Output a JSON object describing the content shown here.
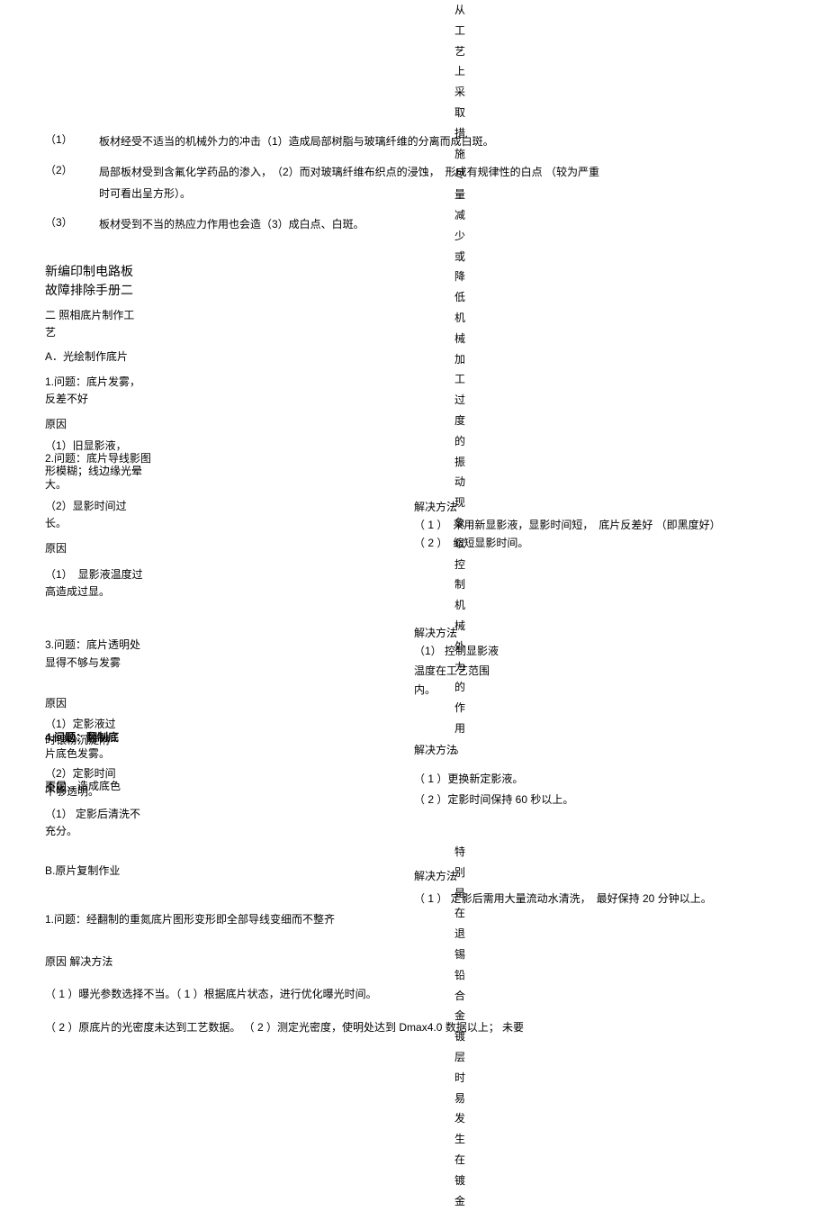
{
  "top_items": [
    {
      "num": "（1）",
      "content": "板材经受不适当的机械外力的冲击（1）造成局部树脂与玻璃纤维的分离而成白斑。",
      "right": "（1）"
    },
    {
      "num": "（2）",
      "content": "局部板材受到含氟化学药品的渗入，　（2）而对玻璃纤维布织点的浸蚀，　形成有规律性的白点 （较为严重时可看出呈方形）。",
      "right": "（2）"
    },
    {
      "num": "（3）",
      "content": "板材受到不当的热应力作用也会造（3）成白点、白斑。",
      "right": "（3）"
    }
  ],
  "title": "新编印制电路板故障排除手册二",
  "sec2": "二  照相底片制作工艺",
  "secA": "A．光绘制作底片",
  "q1": "1.问题：底片发雾，反差不好",
  "cause": "原因",
  "c1a": "（1）旧显影液，",
  "c1b": "2.问题：底片导线影图形模糊；线边缘光晕大。",
  "c1c": "（2）显影时间过长。",
  "c1d": "（1）　显影液温度过高造成过显。",
  "q3": "3.问题：底片透明处显得不够与发雾",
  "c3a": "（1）定影液过",
  "c3b": "4.问题：翻制底",
  "c3c": "时银粉沉淀附",
  "c3d": "片底色发雾。",
  "c3e": "（2）定影时间",
  "c3f": "不足，造成底色",
  "c3g": "原因",
  "c3h": "不够透明。",
  "c3i": "（1） 定影后清洗不充分。",
  "secB": "B.原片复制作业",
  "qB1": "1.问题：经翻制的重氮底片图形变形即全部导线变细而不整齐",
  "causesolve": "原因 解决方法",
  "b1a": "（ 1 ）曝光参数选择不当。（ 1 ）根据底片状态，进行优化曝光时间。",
  "b1b": "（ 2 ）原底片的光密度未达到工艺数据。 （ 2 ）测定光密度，使明处达到  Dmax4.0 数据以上；  未要",
  "vcol1_chars": "从工艺上采取措施尽量减少或降低机械加工过度的振动现象以控制机械外力的作用。",
  "vcol2_chars": "特别是在退锡铅合金镀层时易发生在镀金",
  "solve_label": "解决方法",
  "s1a": "（ 1 ）　采用新显影液，显影时间短，　底片反差好 （即黑度好）",
  "s1b": "（ 2 ）　缩短显影时间。",
  "s2_label": "解决方法",
  "s2a": "（1） 控制显影液温度在工艺范围内。",
  "s3_label": "解决方法",
  "s3a": "（ 1 ）更换新定影液。",
  "s3b": "（ 2 ）定影时间保持 60 秒以上。",
  "s4_label": "解决方法",
  "s4a": "（ 1 ） 定影后需用大量流动水清洗，　最好保持 20 分钟以上。"
}
